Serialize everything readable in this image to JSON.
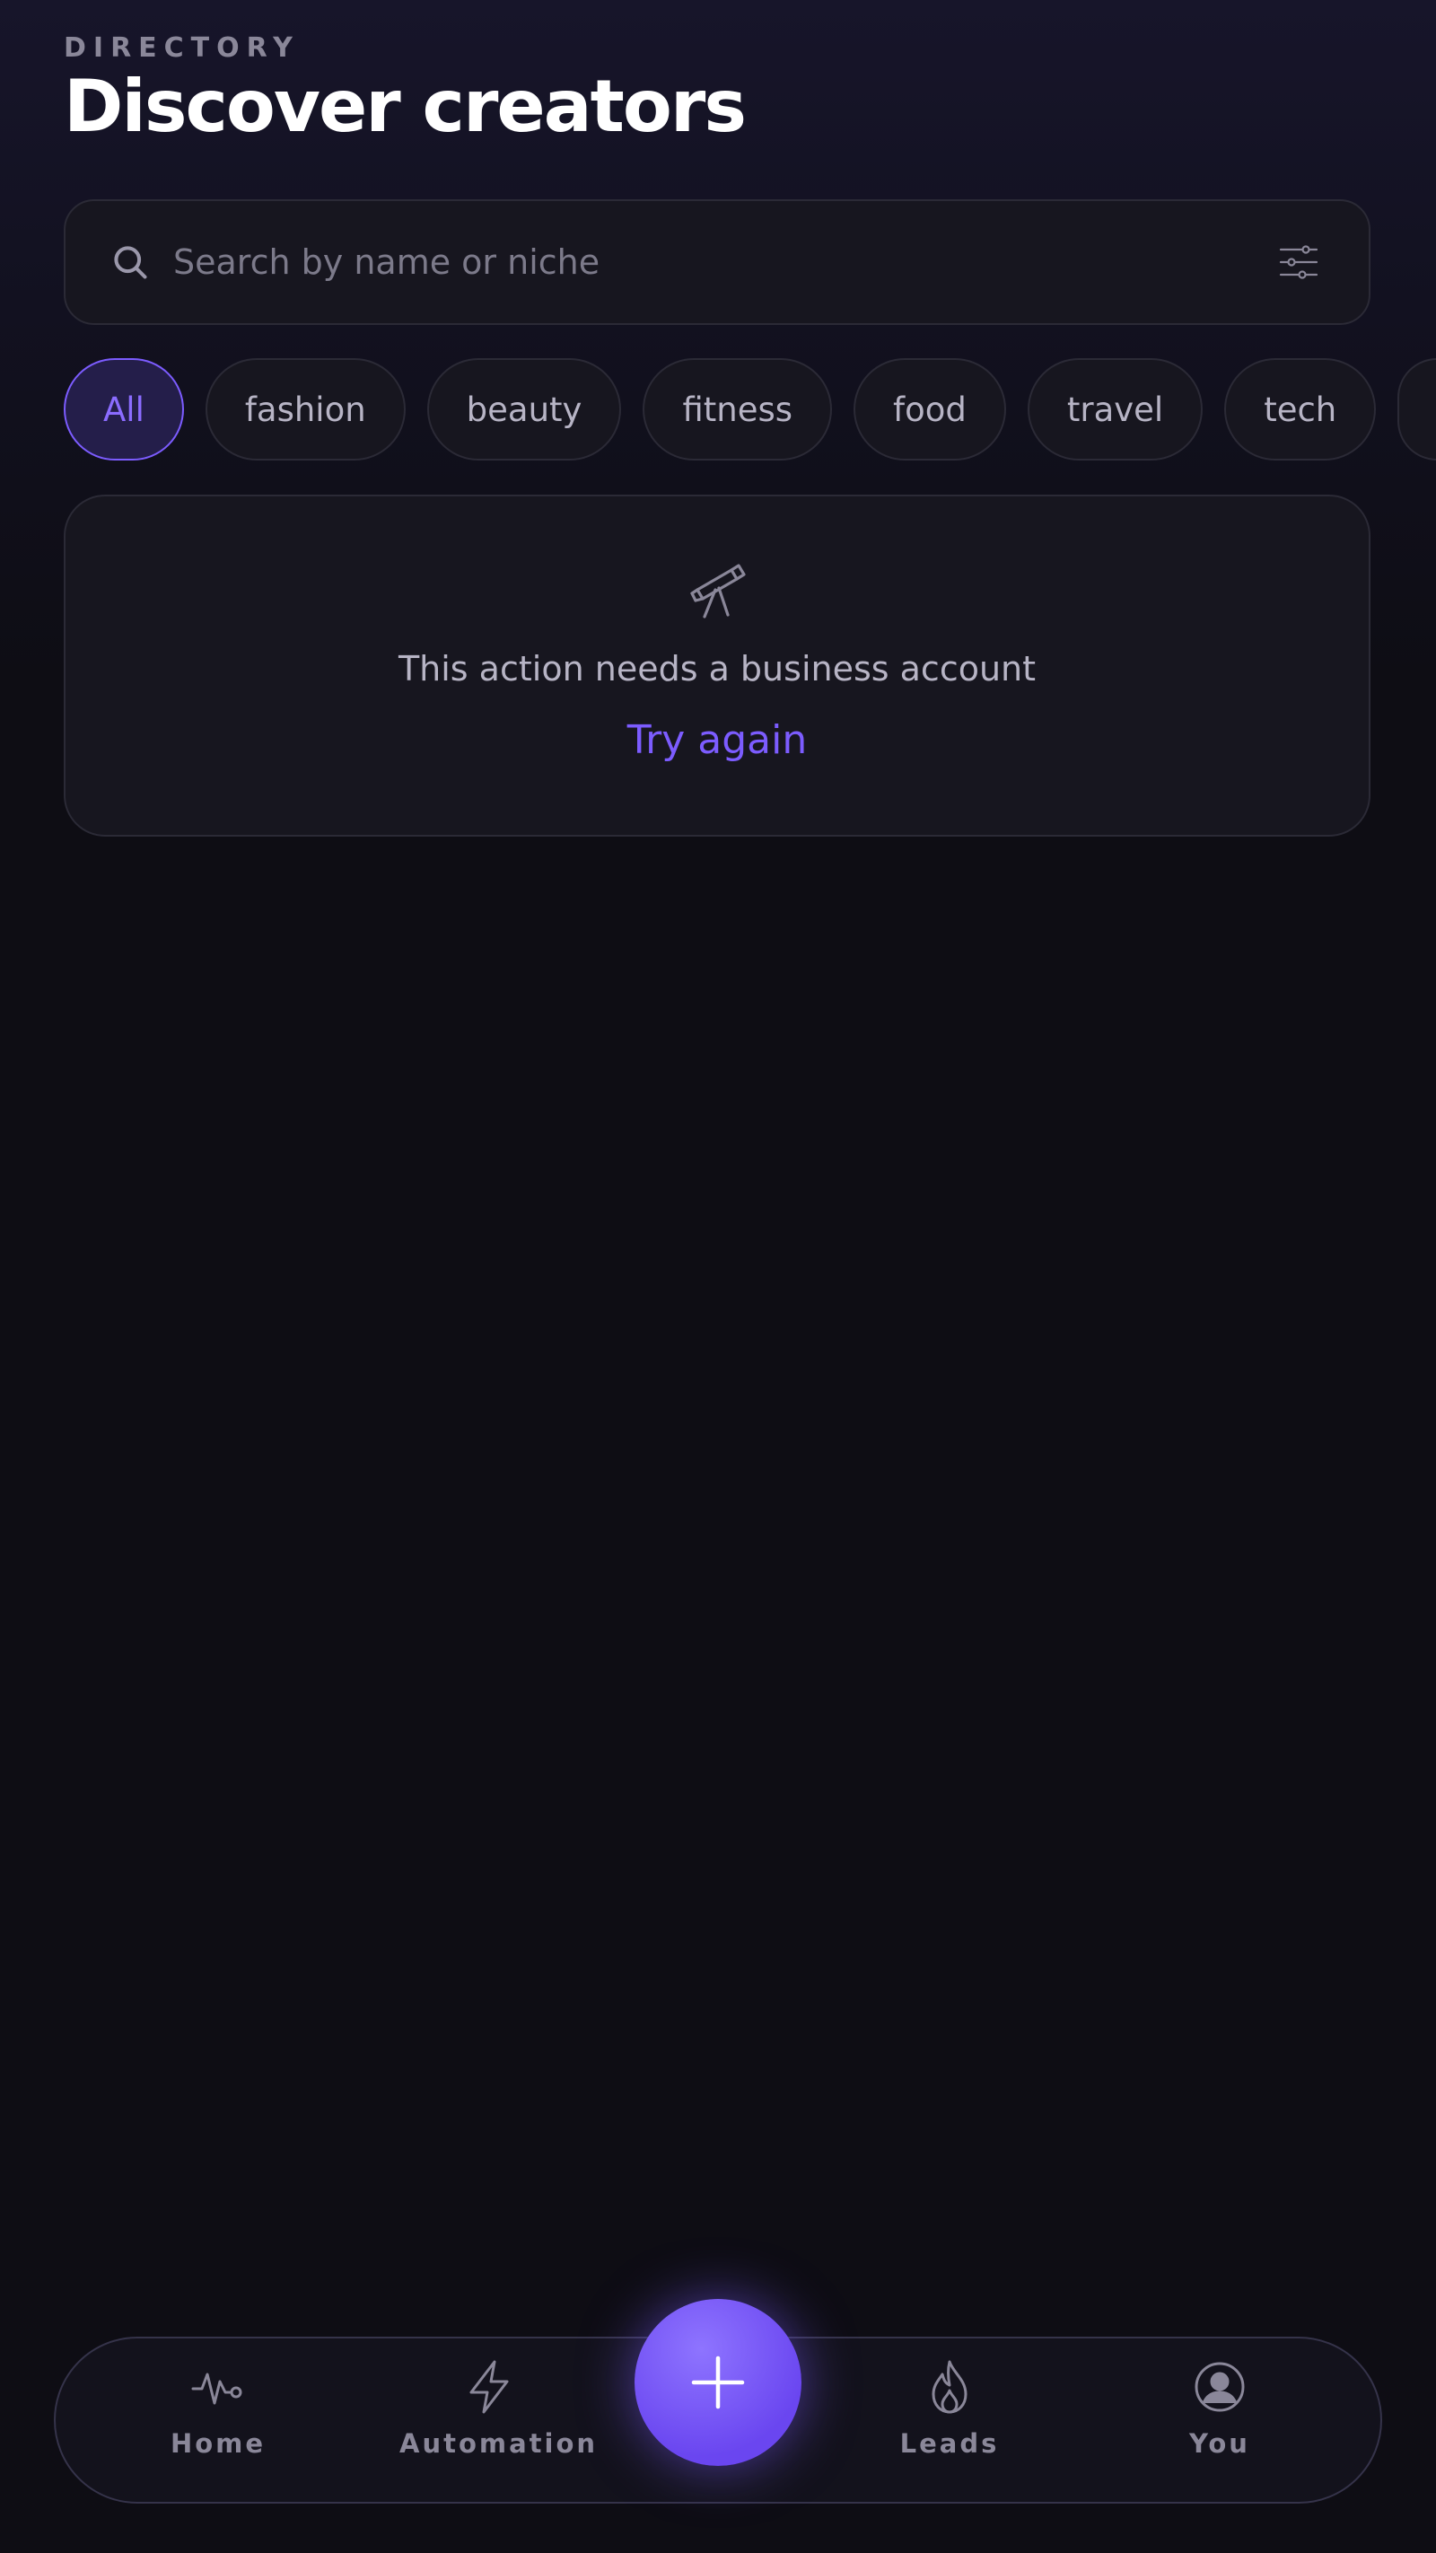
{
  "header": {
    "eyebrow": "DIRECTORY",
    "title": "Discover creators"
  },
  "search": {
    "placeholder": "Search by name or niche",
    "value": ""
  },
  "chips": [
    "All",
    "fashion",
    "beauty",
    "fitness",
    "food",
    "travel",
    "tech",
    ""
  ],
  "active_chip": "All",
  "error_card": {
    "icon": "telescope-icon",
    "message": "This action needs a business account",
    "retry_label": "Try again"
  },
  "nav": {
    "items": [
      {
        "label": "Home",
        "icon": "activity-icon"
      },
      {
        "label": "Automation",
        "icon": "lightning-icon"
      },
      {
        "label": "Leads",
        "icon": "flame-icon"
      },
      {
        "label": "You",
        "icon": "user-circle-icon"
      }
    ],
    "fab_icon": "plus-icon"
  },
  "colors": {
    "accent": "#7c5cff",
    "background": "#0e0d14",
    "surface": "#17161f",
    "muted_text": "#8a8799"
  }
}
